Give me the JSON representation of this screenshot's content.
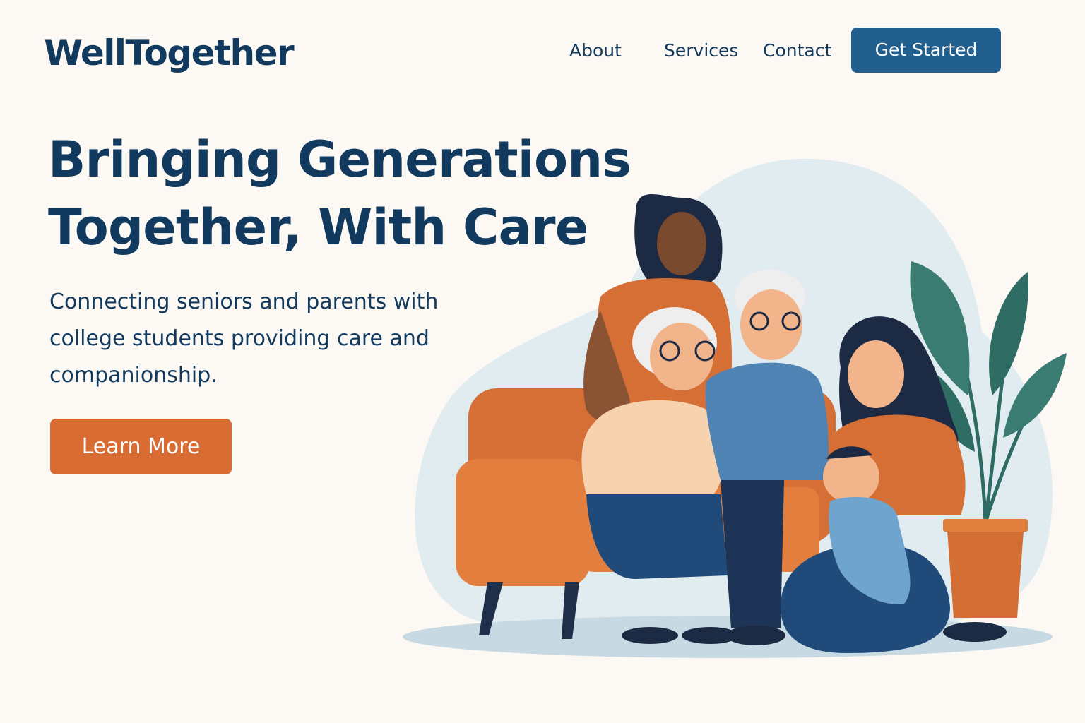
{
  "header": {
    "logo": "WellTogether",
    "nav": {
      "about": "About",
      "services": "Services",
      "contact": "Contact"
    },
    "cta_label": "Get Started"
  },
  "hero": {
    "title_line1": "Bringing Generations",
    "title_line2": "Together, With Care",
    "subtitle_line1": "Connecting seniors and parents with",
    "subtitle_line2": "college students providing care and",
    "subtitle_line3": "companionship.",
    "button_label": "Learn More"
  },
  "colors": {
    "background": "#fcf9f4",
    "primary_navy": "#123a5e",
    "button_blue": "#215f8e",
    "accent_orange": "#d96c33"
  },
  "illustration": {
    "icon": "family-illustration",
    "description_icons": [
      "sofa-icon",
      "plant-icon",
      "baby-icon"
    ]
  }
}
